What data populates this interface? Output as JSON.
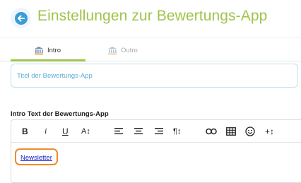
{
  "header": {
    "title": "Einstellungen zur Bewertungs-App",
    "back_icon": "arrow-left-icon",
    "accent": "#9fc44a"
  },
  "tabs": [
    {
      "label": "Intro",
      "icon": "bank-icon",
      "active": true
    },
    {
      "label": "Outro",
      "icon": "bank-icon",
      "active": false
    }
  ],
  "form": {
    "title_placeholder": "Titel der Bewertungs-App",
    "title_value": "",
    "intro_label": "Intro Text der Bewertungs-App"
  },
  "toolbar": {
    "bold": "B",
    "italic": "i",
    "underline": "U",
    "font_size": "A↕",
    "paragraph": "¶↕",
    "more": "+↕"
  },
  "editor": {
    "link_text": "Newsletter",
    "highlight_color": "#f08a2a"
  }
}
